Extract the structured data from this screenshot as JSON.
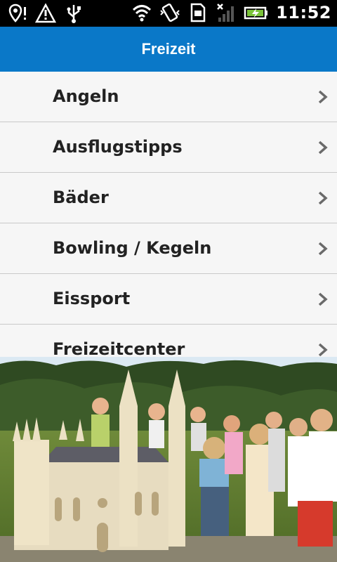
{
  "status_bar": {
    "time": "11:52",
    "icons": [
      "location-alert-icon",
      "warning-icon",
      "usb-icon",
      "wifi-icon",
      "vibrate-icon",
      "sim-icon",
      "signal-icon",
      "battery-charging-icon"
    ]
  },
  "header": {
    "title": "Freizeit"
  },
  "menu": {
    "items": [
      {
        "label": "Angeln"
      },
      {
        "label": "Ausflugstipps"
      },
      {
        "label": "Bäder"
      },
      {
        "label": "Bowling / Kegeln"
      },
      {
        "label": "Eissport"
      },
      {
        "label": "Freizeitcenter"
      }
    ]
  },
  "colors": {
    "header_bg": "#0a78c8",
    "list_bg": "#f6f6f6",
    "divider": "#c9c9c9",
    "text": "#222222"
  }
}
